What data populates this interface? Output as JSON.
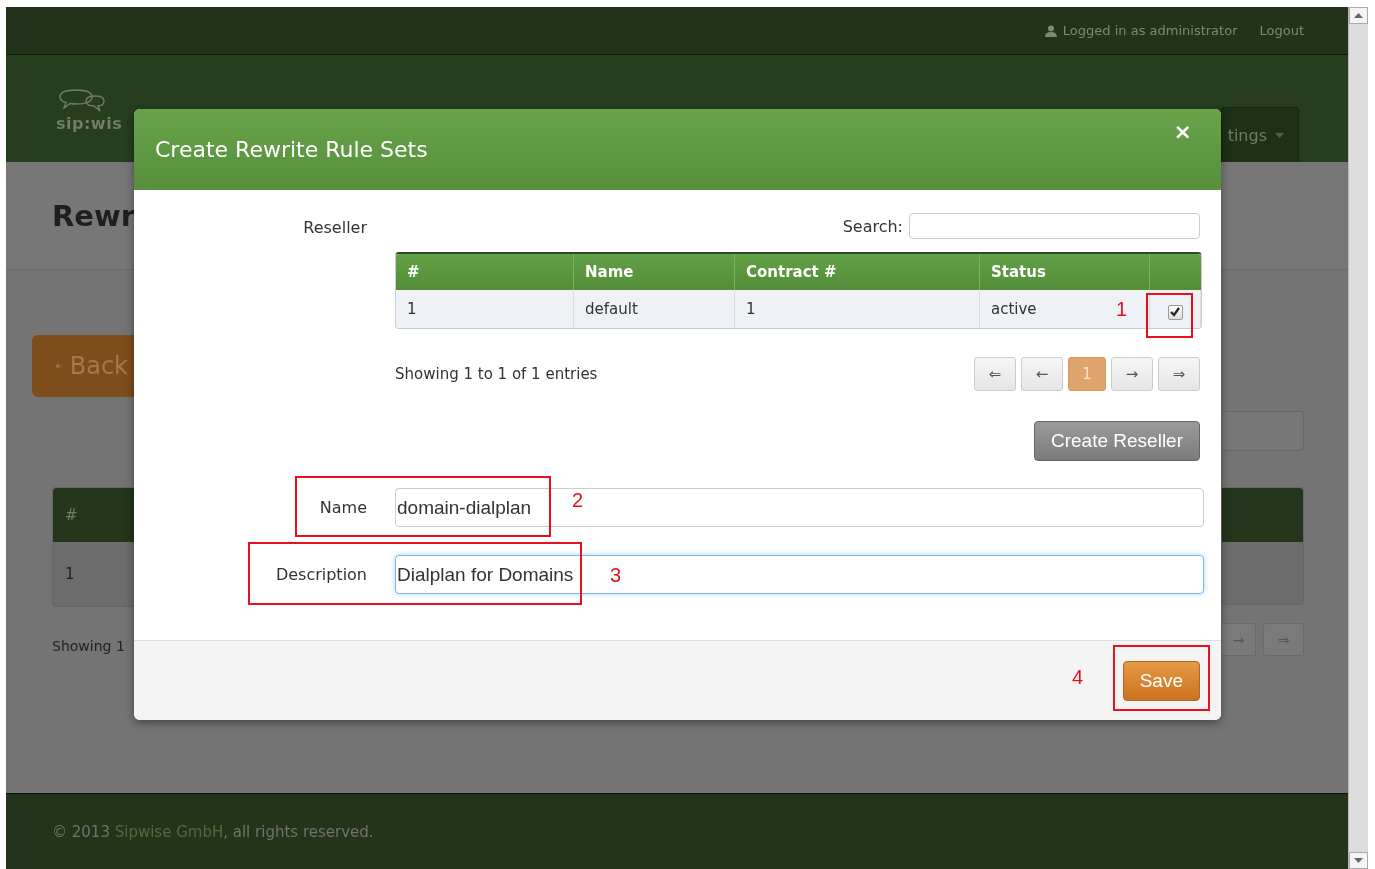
{
  "top_bar": {
    "user_label": "Logged in as administrator",
    "logout": "Logout"
  },
  "nav": {
    "logo": "sip:wis",
    "menu_item": "tings"
  },
  "page": {
    "title": "Rewr",
    "back_button": "Back",
    "table": {
      "columns": [
        "#"
      ],
      "rows": [
        [
          "1"
        ]
      ]
    },
    "info": "Showing 1",
    "pagination": [
      "→",
      "⇒"
    ]
  },
  "modal": {
    "title": "Create Rewrite Rule Sets",
    "close": "×",
    "reseller_label": "Reseller",
    "search_label": "Search:",
    "table": {
      "columns": [
        "#",
        "Name",
        "Contract #",
        "Status"
      ],
      "rows": [
        {
          "cells": [
            "1",
            "default",
            "1",
            "active"
          ],
          "checked": true
        }
      ]
    },
    "info": "Showing 1 to 1 of 1 entries",
    "pagination": [
      {
        "label": "⇐",
        "selected": false
      },
      {
        "label": "←",
        "selected": false
      },
      {
        "label": "1",
        "selected": true
      },
      {
        "label": "→",
        "selected": false
      },
      {
        "label": "⇒",
        "selected": false
      }
    ],
    "create_button": "Create Reseller",
    "fields": [
      {
        "label": "Name",
        "value": "domain-dialplan",
        "focused": false
      },
      {
        "label": "Description",
        "value": "Dialplan for Domains",
        "focused": true
      }
    ],
    "save_button": "Save"
  },
  "annotations": [
    {
      "number": "1"
    },
    {
      "number": "2"
    },
    {
      "number": "3"
    },
    {
      "number": "4"
    }
  ],
  "footer": {
    "prefix": "© 2013 ",
    "link": "Sipwise GmbH",
    "suffix": ", all rights reserved."
  }
}
